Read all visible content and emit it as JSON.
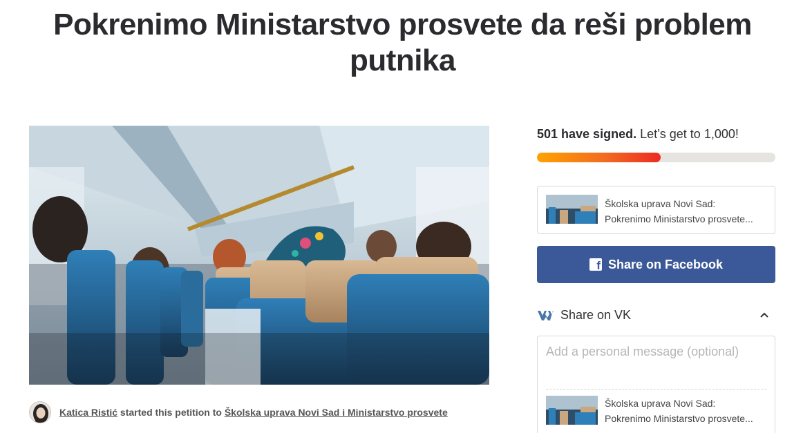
{
  "petition": {
    "title": "Pokrenimo Ministarstvo prosvete da reši problem putnika"
  },
  "starter": {
    "name": "Katica Ristić",
    "middle_text": " started this petition to ",
    "target": "Školska uprava Novi Sad i Ministarstvo prosvete"
  },
  "signatures": {
    "count_text": "501 have signed.",
    "goal_text": " Let’s get to 1,000!",
    "progress_fraction": 0.519
  },
  "preview_card": {
    "line1": "Školska uprava Novi Sad:",
    "line2": "Pokrenimo Ministarstvo prosvete..."
  },
  "share": {
    "facebook_label": "Share on Facebook",
    "vk_label": "Share on VK",
    "message_placeholder": "Add a personal message (optional)"
  },
  "colors": {
    "facebook": "#3b5998",
    "progress_start": "#ffa200",
    "progress_end": "#ec2c22",
    "progress_track": "#e6e4e1",
    "vk": "#4a76a8"
  },
  "icons": {
    "facebook": "facebook-icon",
    "vk": "vk-icon",
    "chevron": "chevron-up-icon"
  }
}
